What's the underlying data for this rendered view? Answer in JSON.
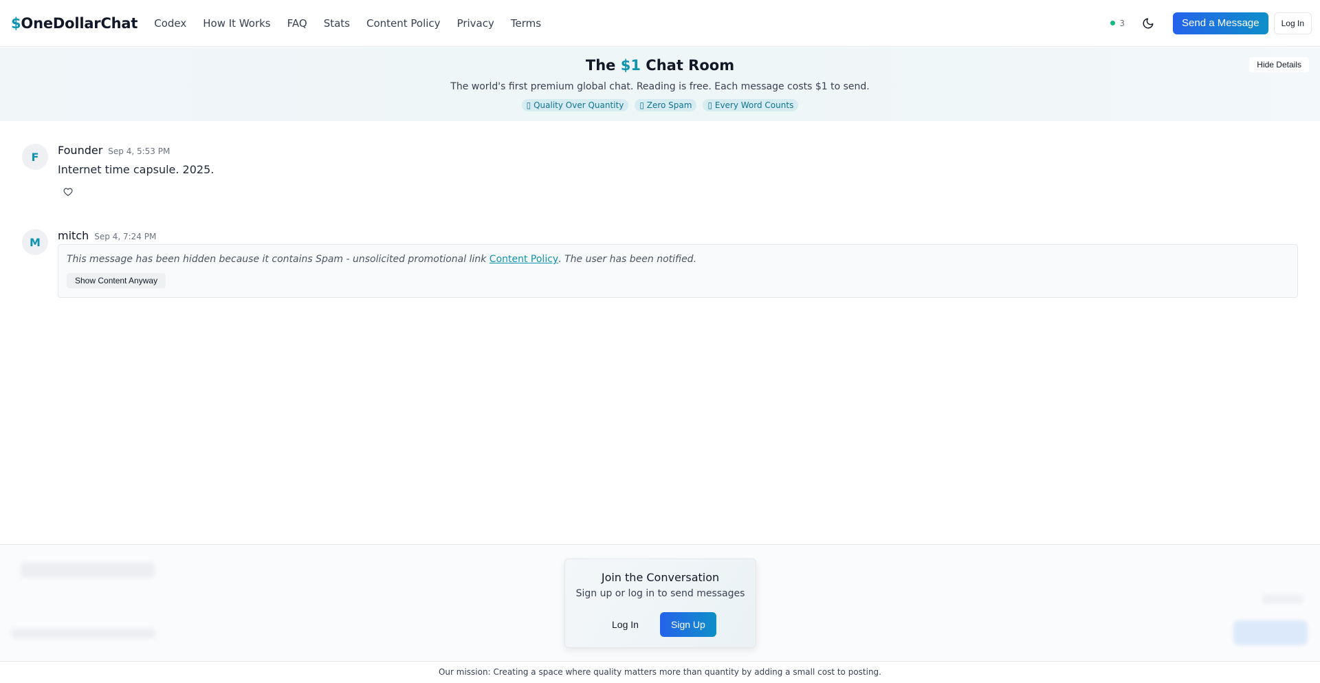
{
  "header": {
    "brand_dollar": "$",
    "brand_name": "OneDollarChat",
    "nav": [
      "Codex",
      "How It Works",
      "FAQ",
      "Stats",
      "Content Policy",
      "Privacy",
      "Terms"
    ],
    "online_count": "3",
    "send_label": "Send a Message",
    "login_label": "Log In"
  },
  "hero": {
    "title_pre": "The ",
    "title_accent": "$1",
    "title_post": " Chat Room",
    "subtitle": "The world's first premium global chat. Reading is free. Each message costs $1 to send.",
    "badges": [
      "▯ Quality Over Quantity",
      "▯ Zero Spam",
      "▯ Every Word Counts"
    ],
    "hide_label": "Hide Details"
  },
  "messages": [
    {
      "initial": "F",
      "author": "Founder",
      "time": "Sep 4, 5:53 PM",
      "text": "Internet time capsule. 2025."
    },
    {
      "initial": "M",
      "author": "mitch",
      "time": "Sep 4, 7:24 PM",
      "hidden_pre": "This message has been hidden because it contains Spam - unsolicited promotional link ",
      "hidden_link": "Content Policy",
      "hidden_post": ". The user has been notified.",
      "show_label": "Show Content Anyway"
    }
  ],
  "join": {
    "title": "Join the Conversation",
    "subtitle": "Sign up or log in to send messages",
    "login_label": "Log In",
    "signup_label": "Sign Up"
  },
  "footer": {
    "mission": "Our mission: Creating a space where quality matters more than quantity by adding a small cost to posting."
  },
  "colors": {
    "accent": "#0e93b0",
    "primary": "#2563eb",
    "online": "#10b981"
  }
}
